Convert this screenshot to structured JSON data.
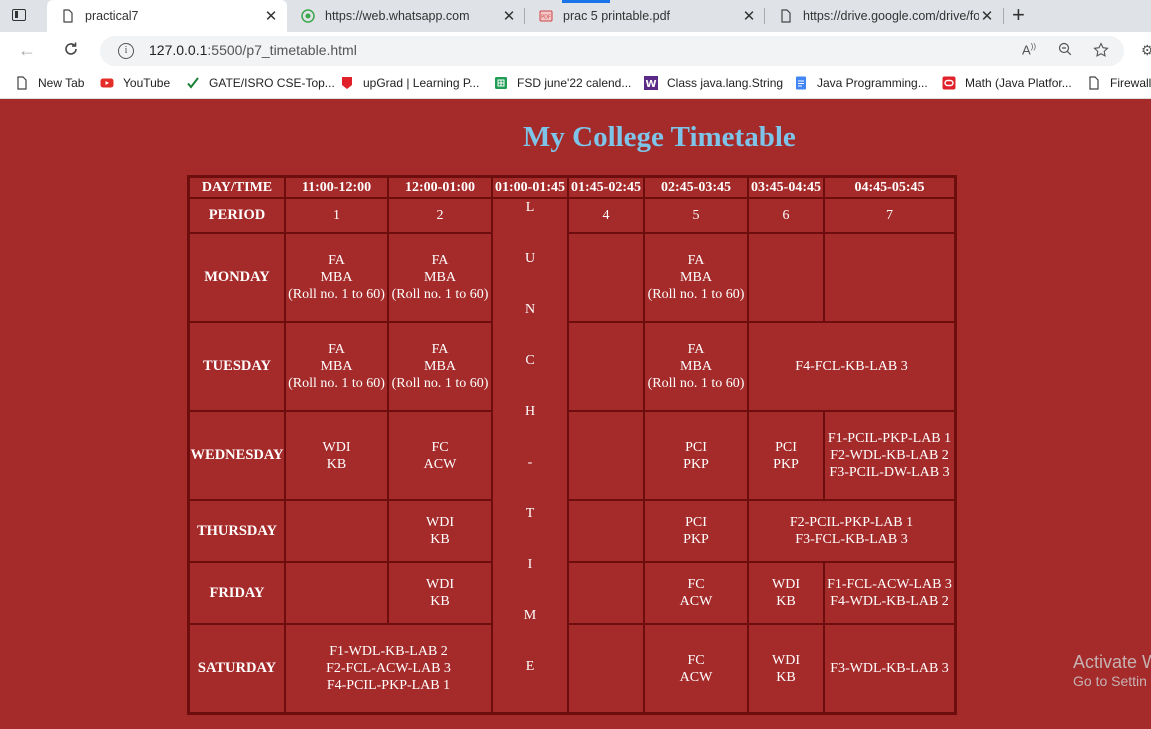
{
  "browser": {
    "tabs": [
      {
        "title": "practical7",
        "icon": "page-icon",
        "active": true
      },
      {
        "title": "https://web.whatsapp.com",
        "icon": "whatsapp-icon",
        "active": false
      },
      {
        "title": "prac 5 printable.pdf",
        "icon": "pdf-icon",
        "active": false
      },
      {
        "title": "https://drive.google.com/drive/fo",
        "icon": "page-icon",
        "active": false
      }
    ],
    "address": {
      "host": "127.0.0.1",
      "rest": ":5500/p7_timetable.html"
    },
    "bookmarks": [
      {
        "label": "New Tab",
        "icon": "page-icon"
      },
      {
        "label": "YouTube",
        "icon": "youtube-icon"
      },
      {
        "label": "GATE/ISRO CSE-Top...",
        "icon": "check-icon"
      },
      {
        "label": "upGrad | Learning P...",
        "icon": "upgrad-icon"
      },
      {
        "label": "FSD june'22 calend...",
        "icon": "sheets-icon"
      },
      {
        "label": "Class java.lang.String",
        "icon": "w-icon"
      },
      {
        "label": "Java Programming...",
        "icon": "docs-icon"
      },
      {
        "label": "Math (Java Platfor...",
        "icon": "oracle-icon"
      },
      {
        "label": "Firewall",
        "icon": "page-icon"
      }
    ]
  },
  "page": {
    "title": "My College Timetable",
    "header": {
      "day_time": "DAY/TIME",
      "slots": [
        "11:00-12:00",
        "12:00-01:00",
        "01:00-01:45",
        "01:45-02:45",
        "02:45-03:45",
        "03:45-04:45",
        "04:45-05:45"
      ]
    },
    "period_row": {
      "label": "PERIOD",
      "numbers": [
        "1",
        "2",
        "4",
        "5",
        "6",
        "7"
      ]
    },
    "lunch_letters": [
      "L",
      "U",
      "N",
      "C",
      "H",
      "-",
      "T",
      "I",
      "M",
      "E"
    ],
    "days": {
      "monday": {
        "label": "MONDAY",
        "p1": [
          "FA",
          "MBA",
          "(Roll no. 1 to 60)"
        ],
        "p2": [
          "FA",
          "MBA",
          "(Roll no. 1 to 60)"
        ],
        "p5": [
          "FA",
          "MBA",
          "(Roll no. 1 to 60)"
        ]
      },
      "tuesday": {
        "label": "TUESDAY",
        "p1": [
          "FA",
          "MBA",
          "(Roll no. 1 to 60)"
        ],
        "p2": [
          "FA",
          "MBA",
          "(Roll no. 1 to 60)"
        ],
        "p5": [
          "FA",
          "MBA",
          "(Roll no. 1 to 60)"
        ],
        "p67": "F4-FCL-KB-LAB 3"
      },
      "wednesday": {
        "label": "WEDNESDAY",
        "p1": [
          "WDI",
          "KB"
        ],
        "p2": [
          "FC",
          "ACW"
        ],
        "p5": [
          "PCI",
          "PKP"
        ],
        "p6": [
          "PCI",
          "PKP"
        ],
        "p7": [
          "F1-PCIL-PKP-LAB 1",
          "F2-WDL-KB-LAB 2",
          "F3-PCIL-DW-LAB 3"
        ]
      },
      "thursday": {
        "label": "THURSDAY",
        "p2": [
          "WDI",
          "KB"
        ],
        "p5": [
          "PCI",
          "PKP"
        ],
        "p67": [
          "F2-PCIL-PKP-LAB 1",
          "F3-FCL-KB-LAB 3"
        ]
      },
      "friday": {
        "label": "FRIDAY",
        "p2": [
          "WDI",
          "KB"
        ],
        "p5": [
          "FC",
          "ACW"
        ],
        "p6": [
          "WDI",
          "KB"
        ],
        "p7": [
          "F1-FCL-ACW-LAB 3",
          "F4-WDL-KB-LAB 2"
        ]
      },
      "saturday": {
        "label": "SATURDAY",
        "p12": [
          "F1-WDL-KB-LAB 2",
          "F2-FCL-ACW-LAB 3",
          "F4-PCIL-PKP-LAB 1"
        ],
        "p5": [
          "FC",
          "ACW"
        ],
        "p6": [
          "WDI",
          "KB"
        ],
        "p7": "F3-WDL-KB-LAB 3"
      }
    }
  },
  "watermark": {
    "line1": "Activate W",
    "line2": "Go to Settin"
  },
  "colors": {
    "background": "#a52a2a",
    "title": "#7ec4e8",
    "border": "#6e0d0d"
  }
}
